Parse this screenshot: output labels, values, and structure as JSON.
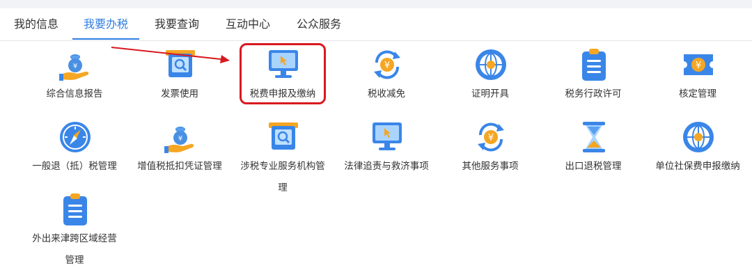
{
  "tabs": [
    {
      "label": "我的信息",
      "active": false
    },
    {
      "label": "我要办税",
      "active": true
    },
    {
      "label": "我要查询",
      "active": false
    },
    {
      "label": "互动中心",
      "active": false
    },
    {
      "label": "公众服务",
      "active": false
    }
  ],
  "items": [
    {
      "label": "综合信息报告",
      "icon": "money-bag-hand-icon"
    },
    {
      "label": "发票使用",
      "icon": "invoice-search-icon"
    },
    {
      "label": "税费申报及缴纳",
      "icon": "monitor-cursor-icon",
      "highlighted": true
    },
    {
      "label": "税收减免",
      "icon": "yuan-refresh-icon"
    },
    {
      "label": "证明开具",
      "icon": "globe-icon"
    },
    {
      "label": "税务行政许可",
      "icon": "clipboard-icon"
    },
    {
      "label": "核定管理",
      "icon": "yuan-ticket-icon"
    },
    {
      "label": "一般退（抵）税管理",
      "icon": "compass-icon"
    },
    {
      "label": "增值税抵扣凭证管理",
      "icon": "money-bag-hand-icon"
    },
    {
      "label": "涉税专业服务机构管",
      "label_line2": "理",
      "icon": "invoice-search-icon"
    },
    {
      "label": "法律追责与救济事项",
      "icon": "monitor-cursor-icon"
    },
    {
      "label": "其他服务事项",
      "icon": "yuan-refresh-icon"
    },
    {
      "label": "出口退税管理",
      "icon": "hourglass-icon"
    },
    {
      "label": "单位社保费申报缴纳",
      "icon": "globe-icon"
    },
    {
      "label": "外出来津跨区域经营",
      "label_line2": "管理",
      "icon": "clipboard-icon"
    }
  ],
  "colors": {
    "accent": "#2f7de0",
    "highlight": "#d71920",
    "icon_blue": "#3a86e8",
    "icon_orange": "#f5a623"
  }
}
